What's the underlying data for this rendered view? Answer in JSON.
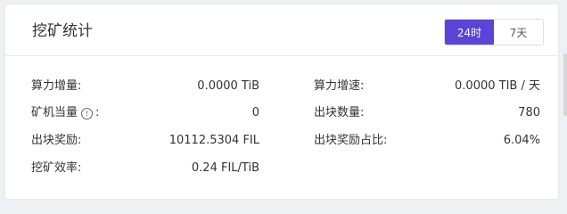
{
  "header": {
    "title": "挖矿统计",
    "range_options": [
      {
        "label": "24时",
        "active": true
      },
      {
        "label": "7天",
        "active": false
      }
    ]
  },
  "stats": {
    "left": [
      {
        "label": "算力增量:",
        "value": "0.0000 TiB"
      },
      {
        "label": "矿机当量",
        "suffix": ":",
        "has_info_icon": true,
        "value": "0"
      },
      {
        "label": "出块奖励:",
        "value": "10112.5304 FIL"
      },
      {
        "label": "挖矿效率:",
        "value": "0.24 FIL/TiB"
      }
    ],
    "right": [
      {
        "label": "算力增速:",
        "value": "0.0000 TIB / 天"
      },
      {
        "label": "出块数量:",
        "value": "780"
      },
      {
        "label": "出块奖励占比:",
        "value": "6.04%"
      }
    ]
  },
  "colors": {
    "accent": "#5b45d8",
    "background": "#eef0f3",
    "card": "#ffffff",
    "text": "#333333"
  },
  "icons": {
    "info": "info-circle-icon",
    "info_glyph": "!"
  }
}
